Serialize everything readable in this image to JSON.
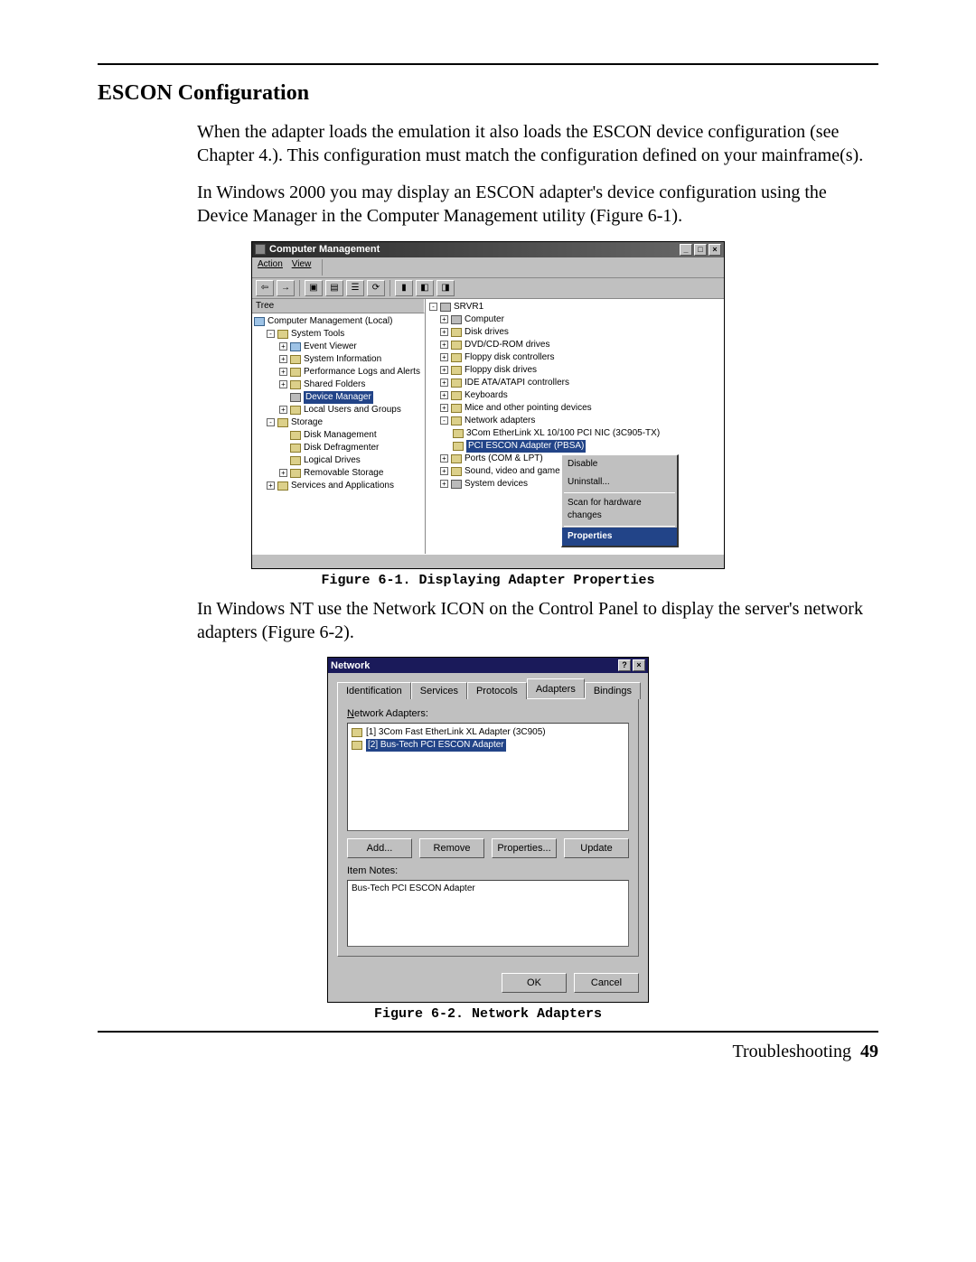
{
  "section_title": "ESCON Configuration",
  "para1": "When the adapter loads the emulation it also loads the ESCON device configuration (see Chapter 4.).  This configuration must match the configuration defined on your mainframe(s).",
  "para2": "In Windows 2000 you may display  an ESCON adapter's device configuration using the Device Manager in the Computer Management utility (Figure 6-1).",
  "para3": "In Windows NT use the Network ICON on the Control Panel to display the server's network adapters (Figure 6-2).",
  "fig1_caption": "Figure 6-1. Displaying Adapter Properties",
  "fig2_caption": "Figure 6-2. Network Adapters",
  "footer_label": "Troubleshooting",
  "footer_page": "49",
  "mmc": {
    "title": "Computer Management",
    "menu_action": "Action",
    "menu_view": "View",
    "tree_tab": "Tree",
    "root": "Computer Management (Local)",
    "systools": "System Tools",
    "eventviewer": "Event Viewer",
    "sysinfo": "System Information",
    "perflogs": "Performance Logs and Alerts",
    "sharedfolders": "Shared Folders",
    "devmgr": "Device Manager",
    "localusers": "Local Users and Groups",
    "storage": "Storage",
    "diskmgmt": "Disk Management",
    "defrag": "Disk Defragmenter",
    "logicaldrives": "Logical Drives",
    "removable": "Removable Storage",
    "services": "Services and Applications",
    "d_root": "SRVR1",
    "d_computer": "Computer",
    "d_disk": "Disk drives",
    "d_dvd": "DVD/CD-ROM drives",
    "d_floppyctl": "Floppy disk controllers",
    "d_floppy": "Floppy disk drives",
    "d_ide": "IDE ATA/ATAPI controllers",
    "d_keyboards": "Keyboards",
    "d_mice": "Mice and other pointing devices",
    "d_netadapt": "Network adapters",
    "d_3com": "3Com EtherLink XL 10/100 PCI NIC (3C905-TX)",
    "d_pciescon": "PCI ESCON Adapter (PBSA)",
    "d_ports": "Ports (COM & LPT)",
    "d_sound": "Sound, video and game controllers",
    "d_sysdev": "System devices",
    "ctx_disable": "Disable",
    "ctx_uninstall": "Uninstall...",
    "ctx_scan": "Scan for hardware changes",
    "ctx_properties": "Properties"
  },
  "nt": {
    "title": "Network",
    "tab_id": "Identification",
    "tab_services": "Services",
    "tab_protocols": "Protocols",
    "tab_adapters": "Adapters",
    "tab_bindings": "Bindings",
    "lbl_netadapters": "Network Adapters:",
    "item1": "[1] 3Com Fast EtherLink XL Adapter (3C905)",
    "item2": "[2] Bus-Tech PCI ESCON Adapter",
    "btn_add": "Add...",
    "btn_remove": "Remove",
    "btn_properties": "Properties...",
    "btn_update": "Update",
    "lbl_itemnotes": "Item Notes:",
    "notes_text": "Bus-Tech PCI ESCON Adapter",
    "btn_ok": "OK",
    "btn_cancel": "Cancel"
  }
}
